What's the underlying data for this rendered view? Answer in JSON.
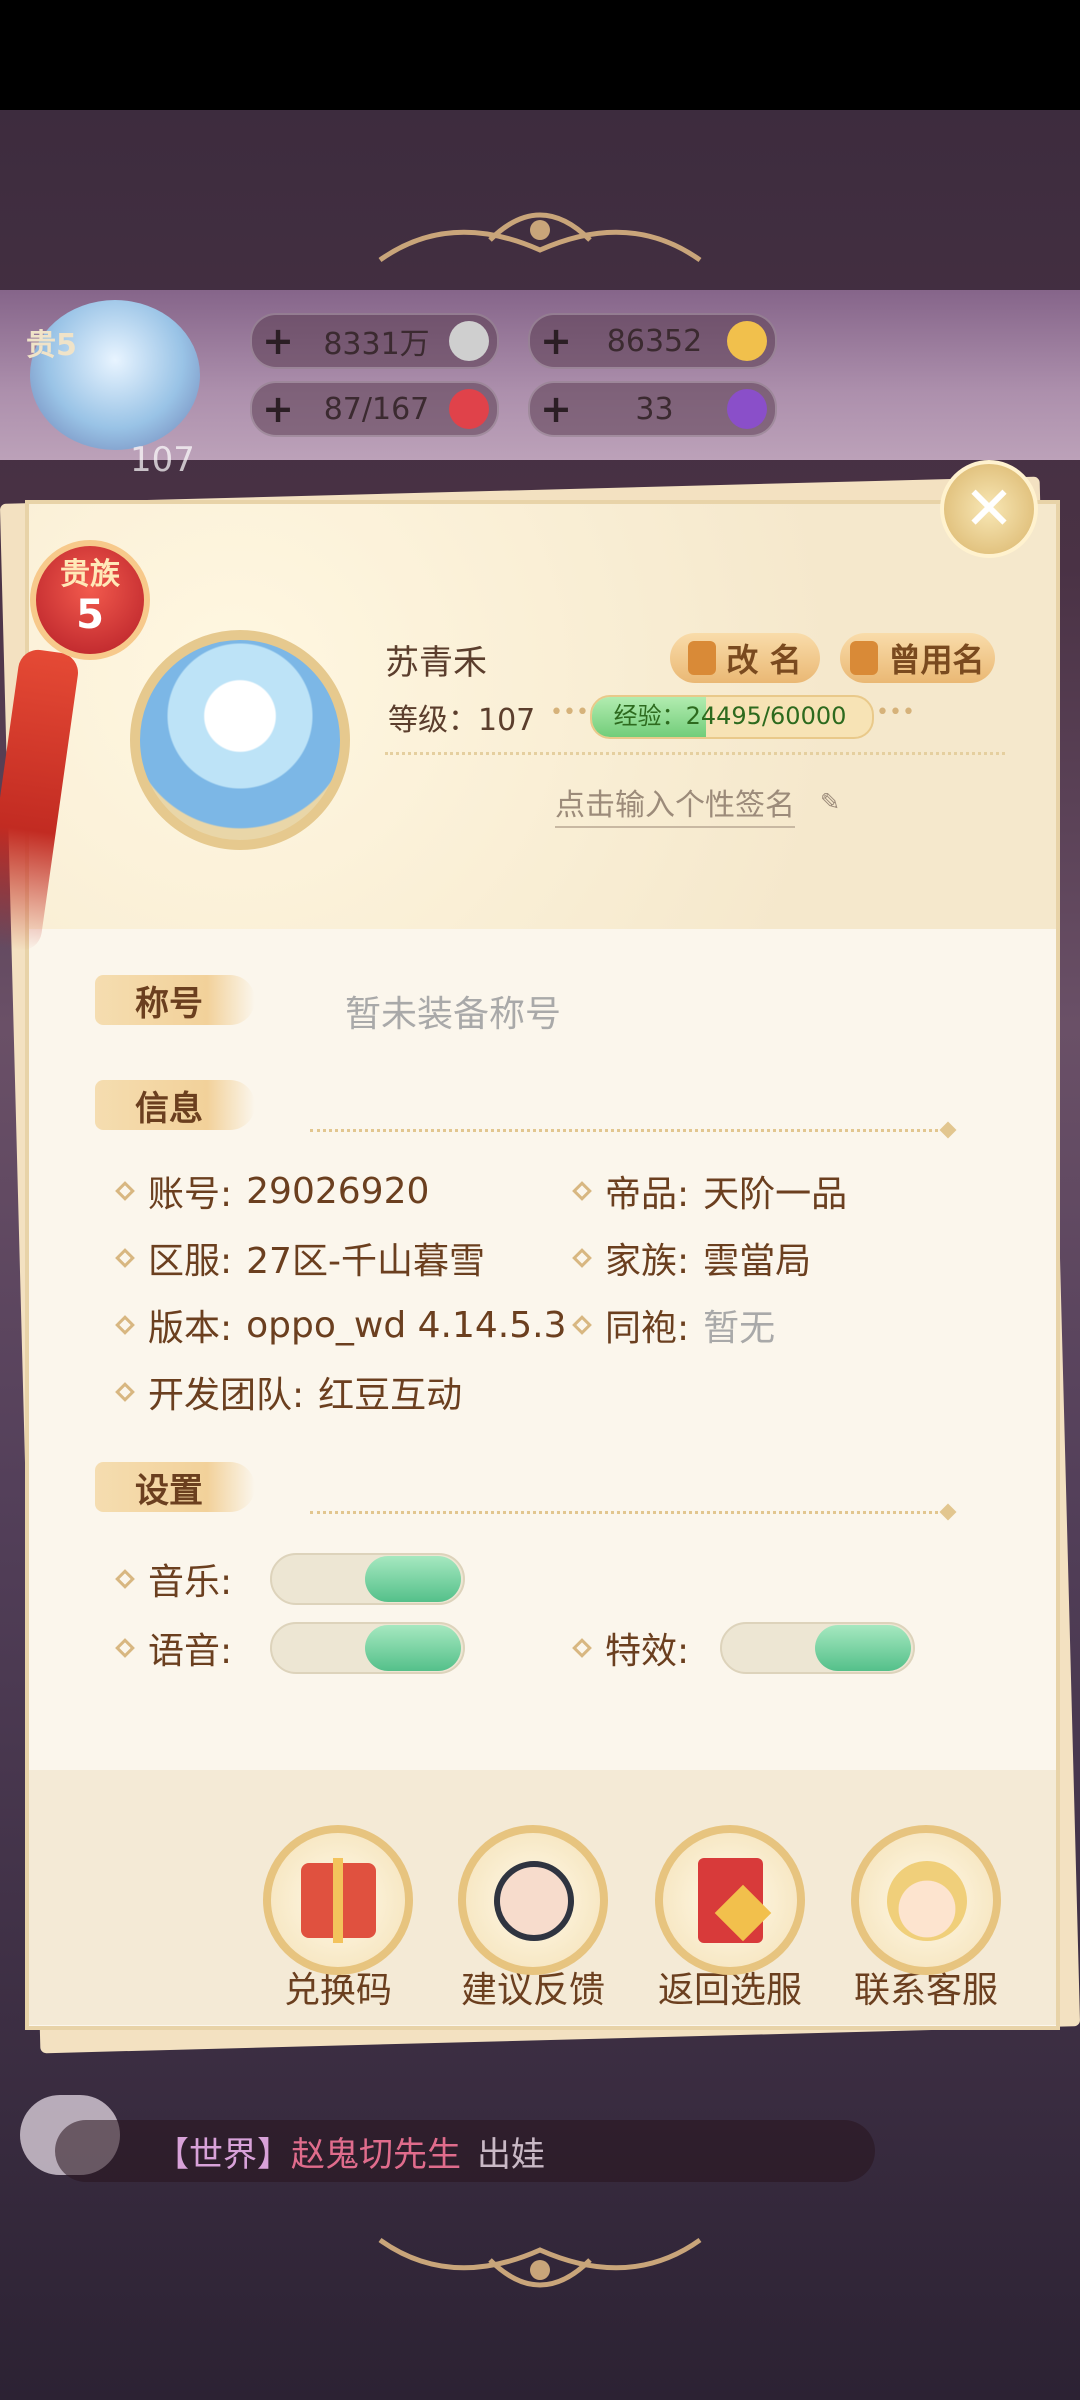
{
  "hud": {
    "rank_label": "贵5",
    "level": "107",
    "resources": [
      {
        "value": "8331万",
        "icon": "coin-icon",
        "color": "#cfcfcf"
      },
      {
        "value": "86352",
        "icon": "gold-ingot-icon",
        "color": "#f1c04c"
      },
      {
        "value": "87/167",
        "icon": "heart-icon",
        "color": "#e0424a"
      },
      {
        "value": "33",
        "icon": "purple-gem-icon",
        "color": "#8a4fc9"
      }
    ],
    "plus": "+"
  },
  "profile": {
    "noble_label": "贵族",
    "noble_level": "5",
    "name": "苏青禾",
    "level_text": "等级：107",
    "exp_text": "经验：24495/60000",
    "exp_fraction": 0.408,
    "rename_label": "改 名",
    "old_name_label": "曾用名",
    "signature_hint": "点击输入个性签名",
    "close_glyph": "✕"
  },
  "title_section": {
    "tag": "称号",
    "value": "暂未装备称号"
  },
  "info_section": {
    "tag": "信息",
    "rows": [
      {
        "label": "账号:",
        "value": "29026920"
      },
      {
        "label": "帝品:",
        "value": "天阶一品"
      },
      {
        "label": "区服:",
        "value": "27区-千山暮雪"
      },
      {
        "label": "家族:",
        "value": "雲當局"
      },
      {
        "label": "版本:",
        "value": "oppo_wd 4.14.5.3"
      },
      {
        "label": "同袍:",
        "value": "暂无"
      },
      {
        "label": "开发团队:",
        "value": "红豆互动"
      }
    ]
  },
  "settings_section": {
    "tag": "设置",
    "music_label": "音乐:",
    "voice_label": "语音:",
    "effects_label": "特效:",
    "music_on": true,
    "voice_on": true,
    "effects_on": true
  },
  "actions": [
    {
      "label": "兑换码"
    },
    {
      "label": "建议反馈"
    },
    {
      "label": "返回选服"
    },
    {
      "label": "联系客服"
    }
  ],
  "chat": {
    "channel": "【世界】",
    "user": "赵鬼切先生",
    "message": "出娃"
  },
  "colors": {
    "accent_gold": "#e7c47f",
    "text_brown": "#6b3f1f",
    "toggle_green": "#54c08a",
    "exp_green": "#72cd7a"
  }
}
